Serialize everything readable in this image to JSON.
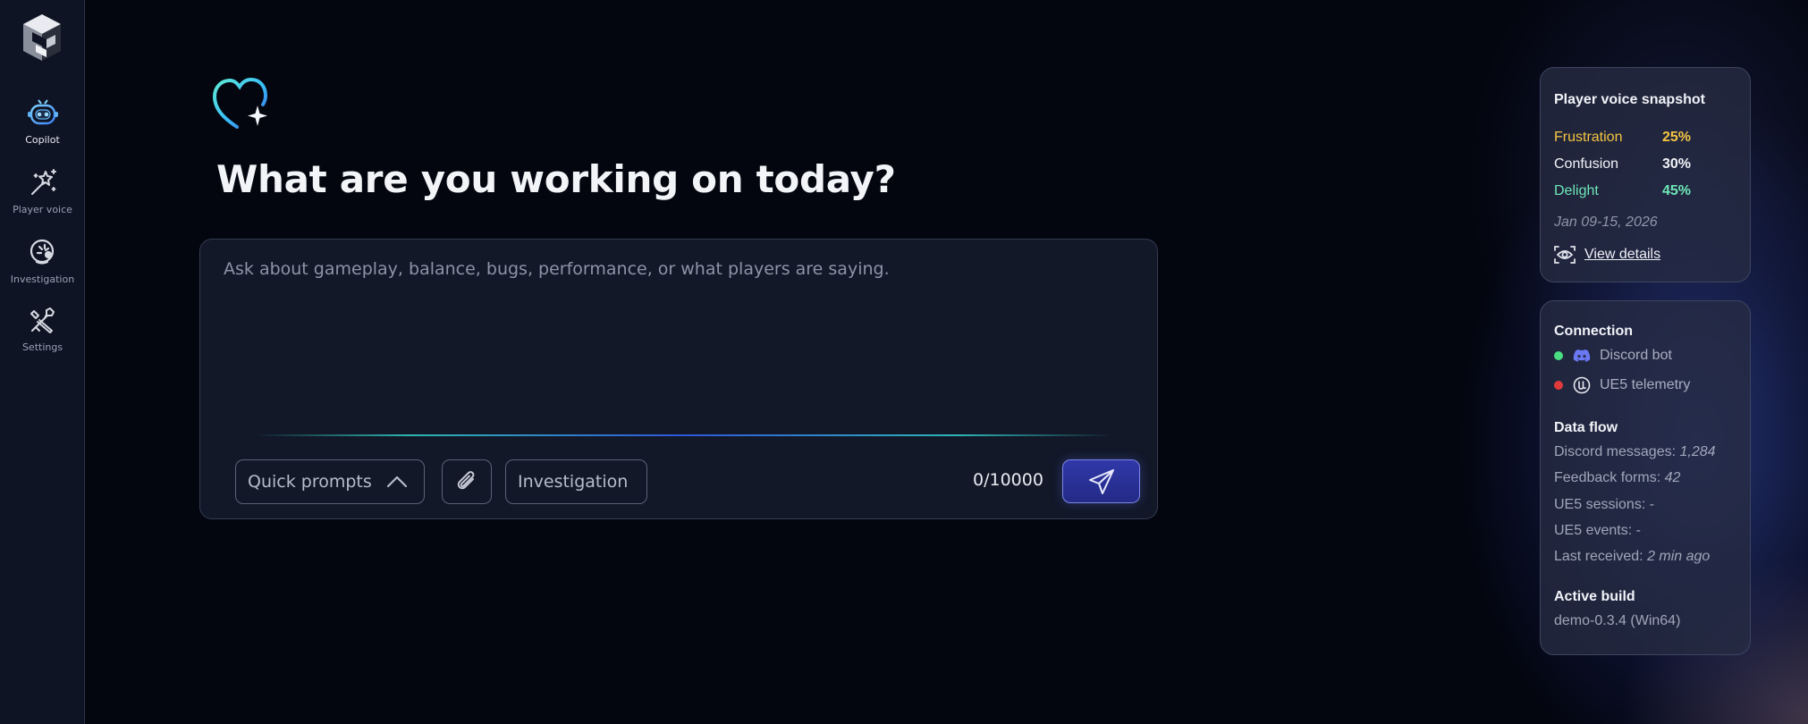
{
  "sidebar": {
    "items": [
      {
        "label": "Copilot",
        "icon": "robot-icon",
        "active": true
      },
      {
        "label": "Player voice",
        "icon": "magic-wand-icon",
        "active": false
      },
      {
        "label": "Investigation",
        "icon": "investigation-icon",
        "active": false
      },
      {
        "label": "Settings",
        "icon": "tools-icon",
        "active": false
      }
    ]
  },
  "main": {
    "title": "What are you working on today?",
    "composer": {
      "placeholder": "Ask about gameplay, balance, bugs, performance, or what players are saying.",
      "value": "",
      "quick_prompts_label": "Quick prompts",
      "investigation_label": "Investigation",
      "counter": "0/10000"
    }
  },
  "snapshot": {
    "title": "Player voice snapshot",
    "stats": [
      {
        "name": "Frustration",
        "pct": "25%",
        "color": "#f5c542"
      },
      {
        "name": "Confusion",
        "pct": "30%",
        "color": "#f1f3f8"
      },
      {
        "name": "Delight",
        "pct": "45%",
        "color": "#6ee7b7"
      }
    ],
    "date_range": "Jan 09-15, 2026",
    "view_details": "View details"
  },
  "connection": {
    "title": "Connection",
    "services": [
      {
        "name": "Discord bot",
        "status_color": "#4ade80",
        "icon": "discord-icon"
      },
      {
        "name": "UE5 telemetry",
        "status_color": "#e03b3b",
        "icon": "unreal-engine-icon"
      }
    ],
    "data_flow_title": "Data flow",
    "data_flow": [
      {
        "label": "Discord messages: ",
        "value": "1,284"
      },
      {
        "label": "Feedback forms: ",
        "value": "42"
      },
      {
        "label": "UE5 sessions: -",
        "value": ""
      },
      {
        "label": "UE5 events: -",
        "value": ""
      },
      {
        "label": "Last received: ",
        "value": "2 min ago"
      }
    ],
    "active_build_title": "Active build",
    "active_build": "demo-0.3.4 (Win64)"
  }
}
